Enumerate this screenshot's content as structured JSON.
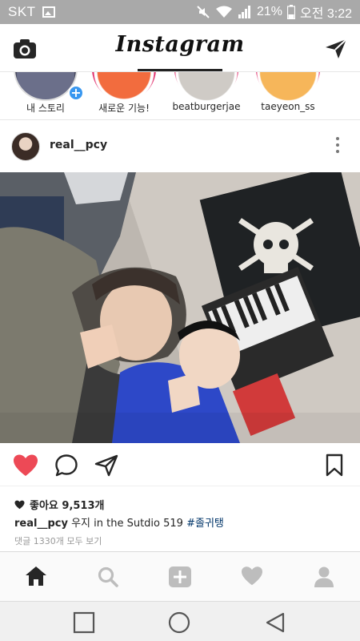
{
  "status_bar": {
    "carrier": "SKT",
    "battery": "21%",
    "time": "오전 3:22"
  },
  "header": {
    "logo": "Instagram"
  },
  "stories": [
    {
      "label": "내 스토리"
    },
    {
      "label": "새로운 기능!"
    },
    {
      "label": "beatburgerjae"
    },
    {
      "label": "taeyeon_ss"
    }
  ],
  "post": {
    "username": "real__pcy",
    "likes": "좋아요 9,513개",
    "caption_user": "real__pcy",
    "caption_text": "우지 in the Sutdio 519",
    "caption_tag": "#졸귀탱",
    "comments_link": "댓글 1330개 모두 보기"
  },
  "icons": {
    "camera": "camera-icon",
    "send": "paper-plane-icon",
    "like": "heart-filled-icon",
    "comment": "speech-bubble-icon",
    "share": "paper-plane-icon",
    "save": "bookmark-icon",
    "home": "home-icon",
    "search": "search-icon",
    "add": "plus-box-icon",
    "activity": "heart-icon",
    "profile": "person-icon"
  },
  "colors": {
    "status_bar": "#a9a9a9",
    "like_red": "#ed4956",
    "hashtag": "#003569",
    "story_ring": "#e1306c"
  }
}
